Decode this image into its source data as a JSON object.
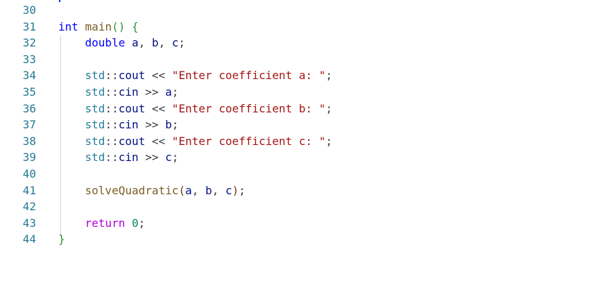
{
  "editor": {
    "lines": [
      {
        "number": "30",
        "tokens": []
      },
      {
        "number": "31",
        "tokens": [
          {
            "text": "int",
            "cls": "kw"
          },
          {
            "text": " ",
            "cls": "op"
          },
          {
            "text": "main",
            "cls": "fn"
          },
          {
            "text": "()",
            "cls": "br2"
          },
          {
            "text": " ",
            "cls": "op"
          },
          {
            "text": "{",
            "cls": "br2"
          }
        ]
      },
      {
        "number": "32",
        "tokens": [
          {
            "text": "    ",
            "cls": "op"
          },
          {
            "text": "double",
            "cls": "kw"
          },
          {
            "text": " ",
            "cls": "op"
          },
          {
            "text": "a",
            "cls": "id"
          },
          {
            "text": ", ",
            "cls": "op"
          },
          {
            "text": "b",
            "cls": "id"
          },
          {
            "text": ", ",
            "cls": "op"
          },
          {
            "text": "c",
            "cls": "id"
          },
          {
            "text": ";",
            "cls": "op"
          }
        ]
      },
      {
        "number": "33",
        "tokens": []
      },
      {
        "number": "34",
        "tokens": [
          {
            "text": "    ",
            "cls": "op"
          },
          {
            "text": "std",
            "cls": "ns"
          },
          {
            "text": "::",
            "cls": "op"
          },
          {
            "text": "cout",
            "cls": "id"
          },
          {
            "text": " << ",
            "cls": "op"
          },
          {
            "text": "\"Enter coefficient a: \"",
            "cls": "str"
          },
          {
            "text": ";",
            "cls": "op"
          }
        ]
      },
      {
        "number": "35",
        "tokens": [
          {
            "text": "    ",
            "cls": "op"
          },
          {
            "text": "std",
            "cls": "ns"
          },
          {
            "text": "::",
            "cls": "op"
          },
          {
            "text": "cin",
            "cls": "id"
          },
          {
            "text": " >> ",
            "cls": "op"
          },
          {
            "text": "a",
            "cls": "id"
          },
          {
            "text": ";",
            "cls": "op"
          }
        ]
      },
      {
        "number": "36",
        "tokens": [
          {
            "text": "    ",
            "cls": "op"
          },
          {
            "text": "std",
            "cls": "ns"
          },
          {
            "text": "::",
            "cls": "op"
          },
          {
            "text": "cout",
            "cls": "id"
          },
          {
            "text": " << ",
            "cls": "op"
          },
          {
            "text": "\"Enter coefficient b: \"",
            "cls": "str"
          },
          {
            "text": ";",
            "cls": "op"
          }
        ]
      },
      {
        "number": "37",
        "tokens": [
          {
            "text": "    ",
            "cls": "op"
          },
          {
            "text": "std",
            "cls": "ns"
          },
          {
            "text": "::",
            "cls": "op"
          },
          {
            "text": "cin",
            "cls": "id"
          },
          {
            "text": " >> ",
            "cls": "op"
          },
          {
            "text": "b",
            "cls": "id"
          },
          {
            "text": ";",
            "cls": "op"
          }
        ]
      },
      {
        "number": "38",
        "tokens": [
          {
            "text": "    ",
            "cls": "op"
          },
          {
            "text": "std",
            "cls": "ns"
          },
          {
            "text": "::",
            "cls": "op"
          },
          {
            "text": "cout",
            "cls": "id"
          },
          {
            "text": " << ",
            "cls": "op"
          },
          {
            "text": "\"Enter coefficient c: \"",
            "cls": "str"
          },
          {
            "text": ";",
            "cls": "op"
          }
        ]
      },
      {
        "number": "39",
        "tokens": [
          {
            "text": "    ",
            "cls": "op"
          },
          {
            "text": "std",
            "cls": "ns"
          },
          {
            "text": "::",
            "cls": "op"
          },
          {
            "text": "cin",
            "cls": "id"
          },
          {
            "text": " >> ",
            "cls": "op"
          },
          {
            "text": "c",
            "cls": "id"
          },
          {
            "text": ";",
            "cls": "op"
          }
        ]
      },
      {
        "number": "40",
        "tokens": []
      },
      {
        "number": "41",
        "tokens": [
          {
            "text": "    ",
            "cls": "op"
          },
          {
            "text": "solveQuadratic",
            "cls": "fn"
          },
          {
            "text": "(",
            "cls": "br3"
          },
          {
            "text": "a",
            "cls": "id"
          },
          {
            "text": ", ",
            "cls": "op"
          },
          {
            "text": "b",
            "cls": "id"
          },
          {
            "text": ", ",
            "cls": "op"
          },
          {
            "text": "c",
            "cls": "id"
          },
          {
            "text": ")",
            "cls": "br3"
          },
          {
            "text": ";",
            "cls": "op"
          }
        ]
      },
      {
        "number": "42",
        "tokens": []
      },
      {
        "number": "43",
        "tokens": [
          {
            "text": "    ",
            "cls": "op"
          },
          {
            "text": "return",
            "cls": "ctl"
          },
          {
            "text": " ",
            "cls": "op"
          },
          {
            "text": "0",
            "cls": "num"
          },
          {
            "text": ";",
            "cls": "op"
          }
        ]
      },
      {
        "number": "44",
        "tokens": [
          {
            "text": "}",
            "cls": "br2"
          }
        ]
      }
    ]
  }
}
